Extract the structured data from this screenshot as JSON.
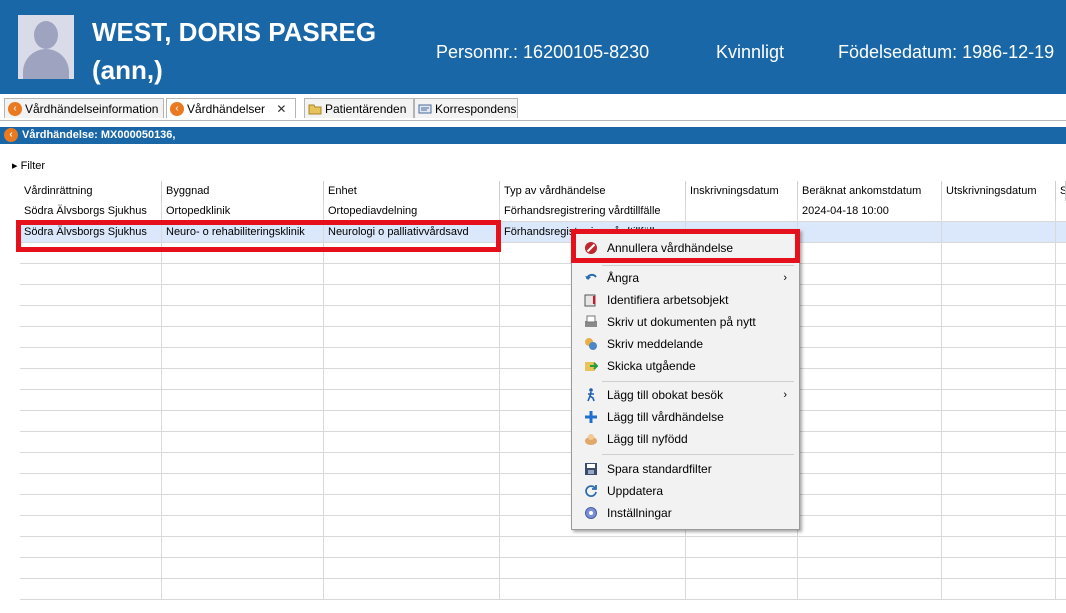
{
  "patient": {
    "name_line1": "WEST, DORIS PASREG",
    "name_line2": "(ann,)",
    "personnr": "Personnr.: 16200105-8230",
    "gender": "Kvinnligt",
    "birthdate": "Födelsedatum: 1986-12-19"
  },
  "tabs": [
    {
      "label": "Vårdhändelseinformation",
      "icon": "care-event-icon"
    },
    {
      "label": "Vårdhändelser",
      "icon": "care-event-icon",
      "close": "✕"
    },
    {
      "label": "Patientärenden",
      "icon": "folder-icon"
    },
    {
      "label": "Korrespondens",
      "icon": "letter-icon"
    }
  ],
  "section": {
    "title": "Vårdhändelse: MX000050136,"
  },
  "filter": {
    "label": "Filter",
    "toggle": "▸"
  },
  "table": {
    "columns": [
      "Vårdinrättning",
      "Byggnad",
      "Enhet",
      "Typ av vårdhändelse",
      "Inskrivningsdatum",
      "Beräknat ankomstdatum",
      "Utskrivningsdatum",
      "S"
    ],
    "rows": [
      [
        "Södra Älvsborgs Sjukhus",
        "Ortopedklinik",
        "Ortopediavdelning",
        "Förhandsregistrering vårdtillfälle",
        "",
        "2024-04-18 10:00",
        "",
        ""
      ],
      [
        "Södra Älvsborgs Sjukhus",
        "Neuro- o rehabiliteringsklinik",
        "Neurologi o palliativvårdsavd",
        "Förhandsregistrering vårdtillfälle",
        "",
        "",
        "",
        ""
      ]
    ]
  },
  "context_menu": {
    "items": [
      {
        "label": "Annullera vårdhändelse",
        "icon": "cancel-icon"
      },
      {
        "label": "Ångra",
        "icon": "undo-icon",
        "submenu": "›"
      },
      {
        "label": "Identifiera arbetsobjekt",
        "icon": "identify-icon"
      },
      {
        "label": "Skriv ut dokumenten på nytt",
        "icon": "print-icon"
      },
      {
        "label": "Skriv meddelande",
        "icon": "message-icon"
      },
      {
        "label": "Skicka utgående",
        "icon": "send-icon"
      },
      {
        "label": "Lägg till obokat besök",
        "icon": "walking-person-icon",
        "submenu": "›"
      },
      {
        "label": "Lägg till vårdhändelse",
        "icon": "plus-icon"
      },
      {
        "label": "Lägg till nyfödd",
        "icon": "baby-icon"
      },
      {
        "label": "Spara standardfilter",
        "icon": "save-icon"
      },
      {
        "label": "Uppdatera",
        "icon": "refresh-icon"
      },
      {
        "label": "Inställningar",
        "icon": "settings-icon"
      }
    ]
  },
  "colors": {
    "header_bg": "#1a67a8",
    "highlight_red": "#e5101c",
    "selected_row": "#dbe8fb"
  }
}
